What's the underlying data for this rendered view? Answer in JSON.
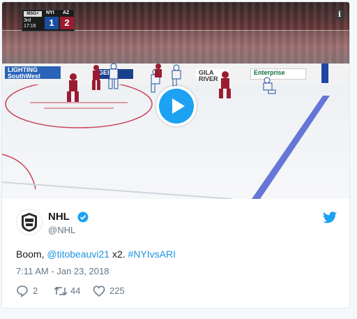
{
  "video": {
    "scoreboard": {
      "network": "MSG+",
      "period": "3rd",
      "clock": "17:16",
      "home_team": "NYI",
      "home_score": "1",
      "away_team": "AZ",
      "away_score": "2"
    },
    "boards": {
      "ad_lighting": "LIGHTING",
      "ad_lighting_sub": "SouthWest",
      "ad_geico": "GEICO",
      "ad_gila": "GILA RIVER",
      "ad_enterprise": "Enterprise"
    },
    "info_label": "i"
  },
  "tweet": {
    "display_name": "NHL",
    "handle": "@NHL",
    "text_prefix": "Boom, ",
    "mention": "@titobeauvi21",
    "text_mid": " x2. ",
    "hashtag": "#NYIvsARI",
    "timestamp": "7:11 AM - Jan 23, 2018",
    "reply_count": "2",
    "retweet_count": "44",
    "like_count": "225"
  },
  "colors": {
    "twitter_blue": "#1da1f2",
    "link_blue": "#1b95e0",
    "muted_gray": "#657786",
    "nyi_blue": "#1b4da0",
    "az_red": "#9b1c31"
  },
  "icons": [
    "info-icon",
    "play-icon",
    "nhl-logo-icon",
    "verified-icon",
    "twitter-bird-icon",
    "reply-icon",
    "retweet-icon",
    "like-icon"
  ]
}
